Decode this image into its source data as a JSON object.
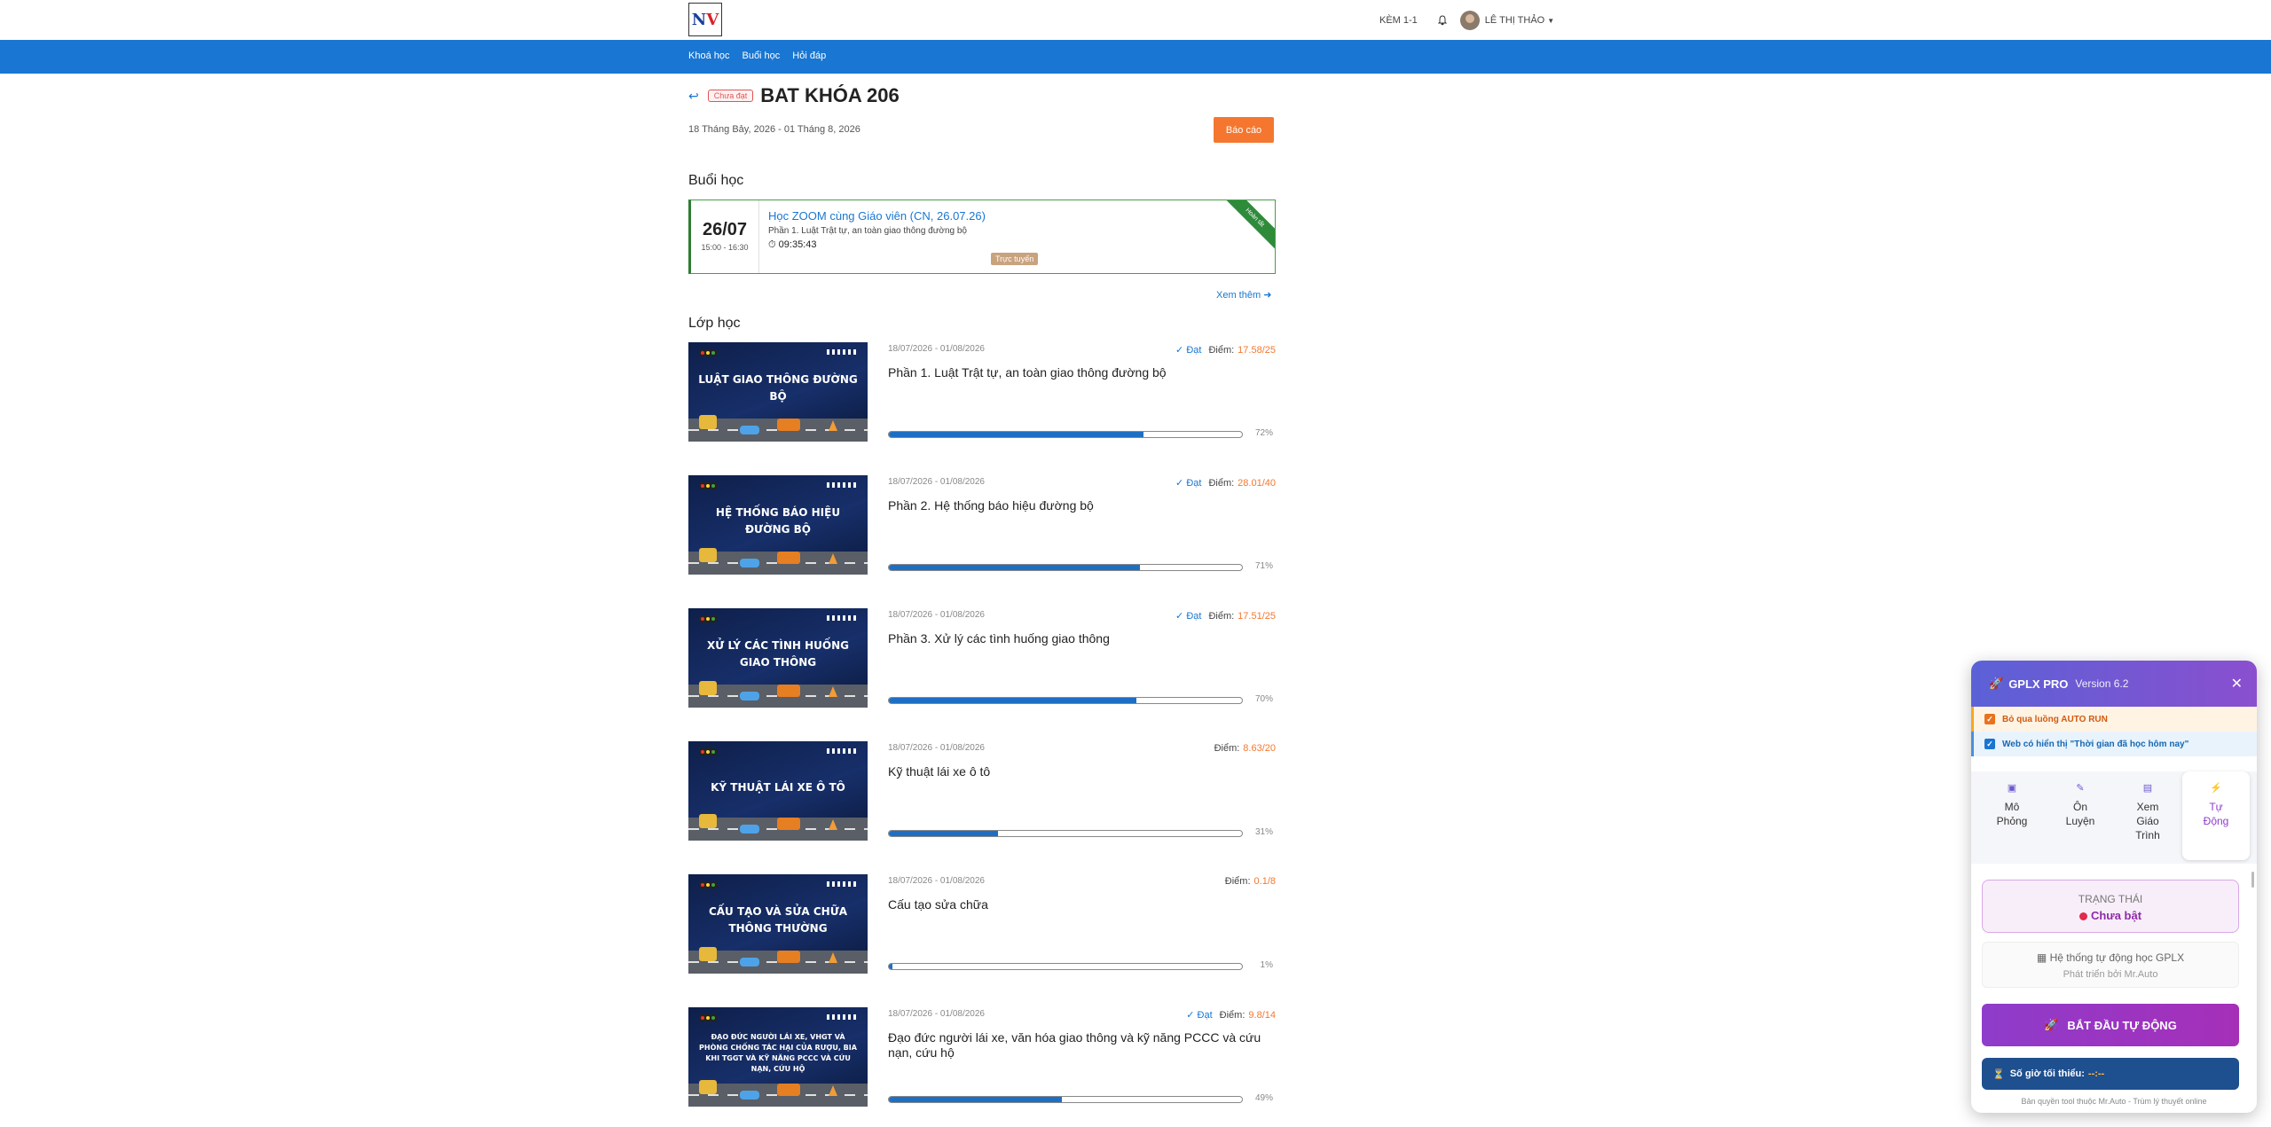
{
  "header": {
    "kem": "KÈM 1-1",
    "user_name": "LÊ THỊ THẢO"
  },
  "nav": {
    "items": [
      "Khoá học",
      "Buổi học",
      "Hỏi đáp"
    ]
  },
  "course": {
    "status_badge": "Chưa đạt",
    "title": "BAT KHÓA 206",
    "date_range": "18 Tháng Bảy, 2026 - 01 Tháng 8, 2026",
    "report_button": "Báo cáo"
  },
  "sessions": {
    "heading": "Buổi học",
    "item": {
      "date": "26/07",
      "time": "15:00 - 16:30",
      "title": "Học ZOOM cùng Giáo viên (CN, 26.07.26)",
      "subtitle": "Phần 1. Luật Trật tự, an toàn giao thông đường bộ",
      "duration": "09:35:43",
      "mode": "Trực tuyến",
      "ribbon": "Hoàn tất"
    },
    "see_more": "Xem thêm"
  },
  "classes": {
    "heading": "Lớp học",
    "items": [
      {
        "thumb": "Luật giao thông đường bộ",
        "date": "18/07/2026 - 01/08/2026",
        "passed": "Đạt",
        "score_label": "Điểm:",
        "score": "17.58/25",
        "title": "Phần 1. Luật Trật tự, an toàn giao thông đường bộ",
        "progress": 72,
        "progress_label": "72%"
      },
      {
        "thumb": "Hệ thống báo hiệu đường bộ",
        "date": "18/07/2026 - 01/08/2026",
        "passed": "Đạt",
        "score_label": "Điểm:",
        "score": "28.01/40",
        "title": "Phần 2. Hệ thống báo hiệu đường bộ",
        "progress": 71,
        "progress_label": "71%"
      },
      {
        "thumb": "Xử lý các tình huống giao thông",
        "date": "18/07/2026 - 01/08/2026",
        "passed": "Đạt",
        "score_label": "Điểm:",
        "score": "17.51/25",
        "title": "Phần 3. Xử lý các tình huống giao thông",
        "progress": 70,
        "progress_label": "70%"
      },
      {
        "thumb": "Kỹ thuật lái xe ô tô",
        "date": "18/07/2026 - 01/08/2026",
        "passed": "",
        "score_label": "Điểm:",
        "score": "8.63/20",
        "title": "Kỹ thuật lái xe ô tô",
        "progress": 31,
        "progress_label": "31%"
      },
      {
        "thumb": "Cấu tạo và sửa chữa thông thường",
        "date": "18/07/2026 - 01/08/2026",
        "passed": "",
        "score_label": "Điểm:",
        "score": "0.1/8",
        "title": "Cấu tạo sửa chữa",
        "progress": 1,
        "progress_label": "1%"
      },
      {
        "thumb": "Đạo đức người lái xe, VHGT và phòng chống tác hại của rượu, bia khi TGGT và kỹ năng PCCC và cứu nạn, cứu hộ",
        "date": "18/07/2026 - 01/08/2026",
        "passed": "Đạt",
        "score_label": "Điểm:",
        "score": "9.8/14",
        "title": "Đạo đức người lái xe, văn hóa giao thông và kỹ năng PCCC và cứu nạn, cứu hộ",
        "progress": 49,
        "progress_label": "49%"
      }
    ]
  },
  "panel": {
    "name": "GPLX PRO",
    "version": "Version 6.2",
    "opt1": "Bỏ qua luồng AUTO RUN",
    "opt2": "Web có hiển thị \"Thời gian đã học hôm nay\"",
    "tabs": [
      {
        "label": "Mô Phỏng",
        "icon": "simulation-icon"
      },
      {
        "label": "Ôn Luyện",
        "icon": "practice-icon"
      },
      {
        "label": "Xem Giáo Trình",
        "icon": "book-icon"
      },
      {
        "label": "Tự Động",
        "icon": "lightning-icon"
      }
    ],
    "status_label": "TRẠNG THÁI",
    "status_value": "Chưa bật",
    "sys_title": "Hệ thống tự động học GPLX",
    "sys_by": "Phát triển bởi Mr.Auto",
    "start_button": "BẮT ĐẦU TỰ ĐỘNG",
    "min_hours_label": "Số giờ tối thiểu:",
    "min_hours_value": "--:--",
    "copyright": "Bản quyền tool thuộc Mr.Auto - Trùm lý thuyết online"
  },
  "colors": {
    "nav_blue": "#1976d2",
    "accent_orange": "#f5772f",
    "session_green": "#43a047",
    "panel_purple": "#8e3ccb"
  }
}
